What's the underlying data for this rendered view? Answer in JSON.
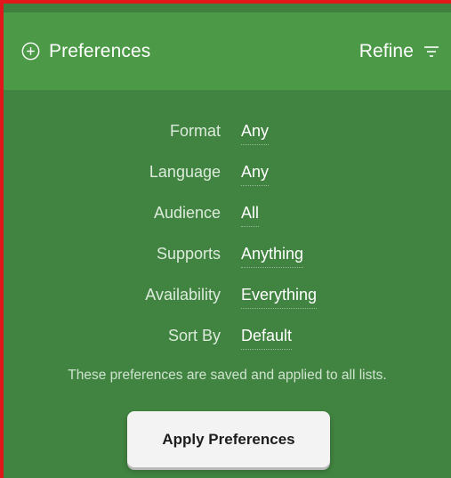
{
  "header": {
    "title": "Preferences",
    "title_icon": "plus-circle-icon",
    "refine_label": "Refine",
    "refine_icon": "filter-lines-icon"
  },
  "preferences": [
    {
      "label": "Format",
      "value": "Any"
    },
    {
      "label": "Language",
      "value": "Any"
    },
    {
      "label": "Audience",
      "value": "All"
    },
    {
      "label": "Supports",
      "value": "Anything"
    },
    {
      "label": "Availability",
      "value": "Everything"
    },
    {
      "label": "Sort By",
      "value": "Default"
    }
  ],
  "note": "These preferences are saved and applied to all lists.",
  "apply_button_label": "Apply Preferences",
  "colors": {
    "frame_border": "#e0181b",
    "header_bg": "#4c9a48",
    "body_bg": "#418340",
    "button_bg": "#f3f3f3"
  }
}
